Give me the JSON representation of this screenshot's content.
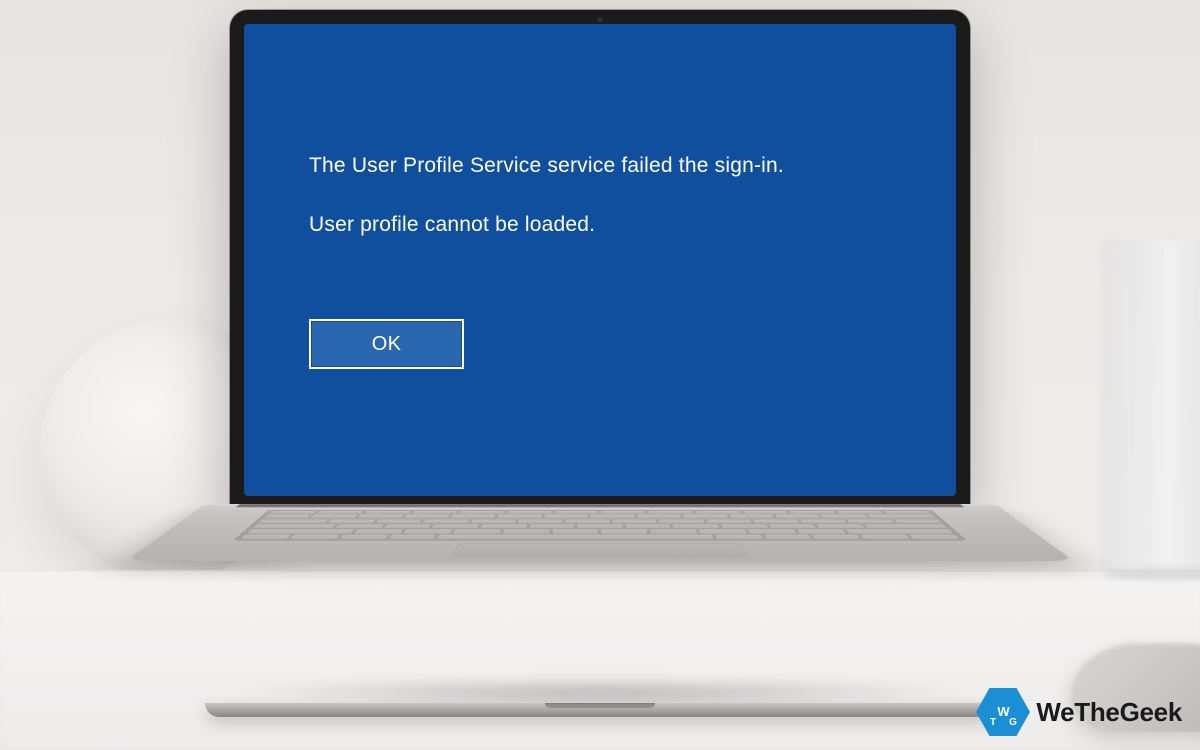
{
  "error": {
    "primary": "The User Profile Service service failed the sign-in.",
    "secondary": "User profile cannot be loaded.",
    "ok_label": "OK"
  },
  "watermark": {
    "brand": "WeTheGeek",
    "icon_letters": "WTG",
    "accent_color": "#1a8fd4"
  },
  "colors": {
    "screen_bg": "#0f4f9e",
    "button_bg": "#2a67b0",
    "button_border": "#ffffff"
  }
}
